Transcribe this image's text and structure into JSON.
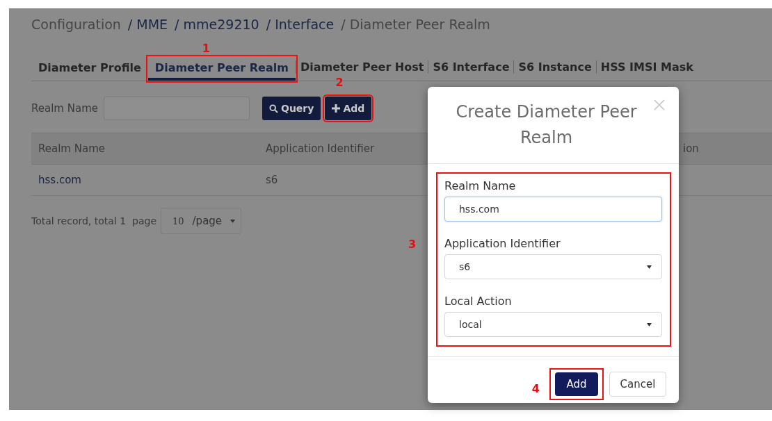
{
  "breadcrumb": [
    {
      "label": "Configuration",
      "link": false
    },
    {
      "label": "/ MME",
      "link": true
    },
    {
      "label": "/ mme29210",
      "link": true
    },
    {
      "label": "/ Interface",
      "link": true
    },
    {
      "label": "/ Diameter Peer Realm",
      "link": false
    }
  ],
  "tabs": [
    {
      "label": "Diameter Profile",
      "selected": false
    },
    {
      "label": "Diameter Peer Realm",
      "selected": true,
      "callout": "1"
    },
    {
      "label": "Diameter Peer Host",
      "selected": false
    },
    {
      "label": "S6 Interface",
      "selected": false
    },
    {
      "label": "S6 Instance",
      "selected": false
    },
    {
      "label": "HSS IMSI Mask",
      "selected": false
    }
  ],
  "search": {
    "label": "Realm Name",
    "query_button": "Query",
    "add_button": "Add",
    "add_callout": "2"
  },
  "table": {
    "columns": [
      "Realm Name",
      "Application Identifier",
      "ion"
    ],
    "rows": [
      [
        "hss.com",
        "s6"
      ]
    ]
  },
  "pagination": {
    "text": "Total record, total 1  page",
    "page_size": "10",
    "unit": "/page"
  },
  "dialog": {
    "title": "Create Diameter Peer Realm",
    "form_callout": "3",
    "fields": [
      {
        "kind": "text",
        "label": "Realm Name",
        "value": "hss.com"
      },
      {
        "kind": "select",
        "label": "Application Identifier",
        "value": "s6"
      },
      {
        "kind": "select",
        "label": "Local Action",
        "value": "local"
      }
    ],
    "buttons": [
      {
        "label": "Add",
        "primary": true,
        "callout": "4"
      },
      {
        "label": "Cancel",
        "primary": false
      }
    ]
  }
}
